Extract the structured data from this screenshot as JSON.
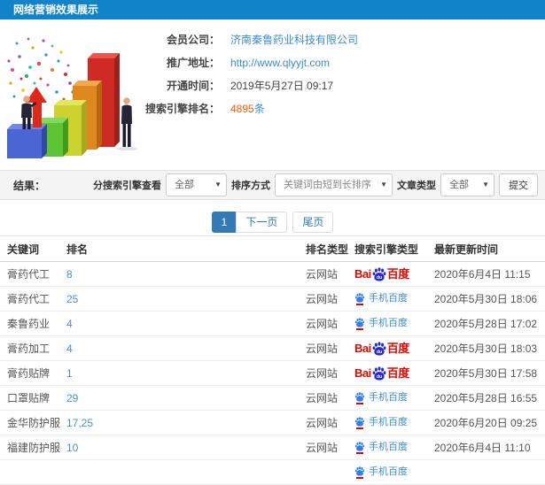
{
  "window": {
    "title": "网络营销效果展示"
  },
  "profile": {
    "company_label": "会员公司：",
    "company_value": "济南秦鲁药业科技有限公司",
    "url_label": "推广地址：",
    "url_value": "http://www.qlyyjt.com",
    "opened_label": "开通时间：",
    "opened_value": "2019年5月27日 09:17",
    "rank_label": "搜索引擎排名：",
    "rank_count": "4895",
    "rank_unit": "条"
  },
  "filters": {
    "result_label": "结果：",
    "engine_label": "分搜索引擎查看",
    "engine_value": "全部",
    "sort_label": "排序方式",
    "sort_value": "关键词由短到长排序",
    "article_label": "文章类型",
    "article_value": "全部",
    "submit_label": "提交"
  },
  "pagination": {
    "page": "1",
    "next_label": "下一页",
    "last_label": "尾页"
  },
  "table": {
    "headers": [
      "关键词",
      "排名",
      "排名类型",
      "搜索引擎类型",
      "最新更新时间"
    ],
    "rows": [
      {
        "keyword": "膏药代工",
        "rank": "8",
        "rank_type": "云网站",
        "engine": "baidu-pc",
        "updated": "2020年6月4日 11:15"
      },
      {
        "keyword": "膏药代工",
        "rank": "25",
        "rank_type": "云网站",
        "engine": "baidu-mobile",
        "updated": "2020年5月30日 18:06"
      },
      {
        "keyword": "秦鲁药业",
        "rank": "4",
        "rank_type": "云网站",
        "engine": "baidu-mobile",
        "updated": "2020年5月28日 17:02"
      },
      {
        "keyword": "膏药加工",
        "rank": "4",
        "rank_type": "云网站",
        "engine": "baidu-pc",
        "updated": "2020年5月30日 18:03"
      },
      {
        "keyword": "膏药贴牌",
        "rank": "1",
        "rank_type": "云网站",
        "engine": "baidu-pc",
        "updated": "2020年5月30日 17:58"
      },
      {
        "keyword": "口罩贴牌",
        "rank": "29",
        "rank_type": "云网站",
        "engine": "baidu-mobile",
        "updated": "2020年5月28日 16:55"
      },
      {
        "keyword": "金华防护服",
        "rank": "17,25",
        "rank_type": "云网站",
        "engine": "baidu-mobile",
        "updated": "2020年6月20日 09:25"
      },
      {
        "keyword": "福建防护服",
        "rank": "10",
        "rank_type": "云网站",
        "engine": "baidu-mobile",
        "updated": "2020年6月4日 11:10"
      },
      {
        "keyword": "",
        "rank": "",
        "rank_type": "",
        "engine": "baidu-mobile",
        "updated": ""
      }
    ]
  },
  "engines": {
    "baidu-pc": {
      "prefix": "Bai",
      "paw_text": "du",
      "suffix": "百度"
    },
    "baidu-mobile": {
      "label": "手机百度"
    }
  },
  "colors": {
    "header_bg": "#1183c8",
    "link_blue": "#3b8dd1",
    "highlight_red": "#ff5a00",
    "pager_blue": "#337ab7",
    "baidu_red": "#dd0a01",
    "baidu_blue": "#2629d8"
  }
}
